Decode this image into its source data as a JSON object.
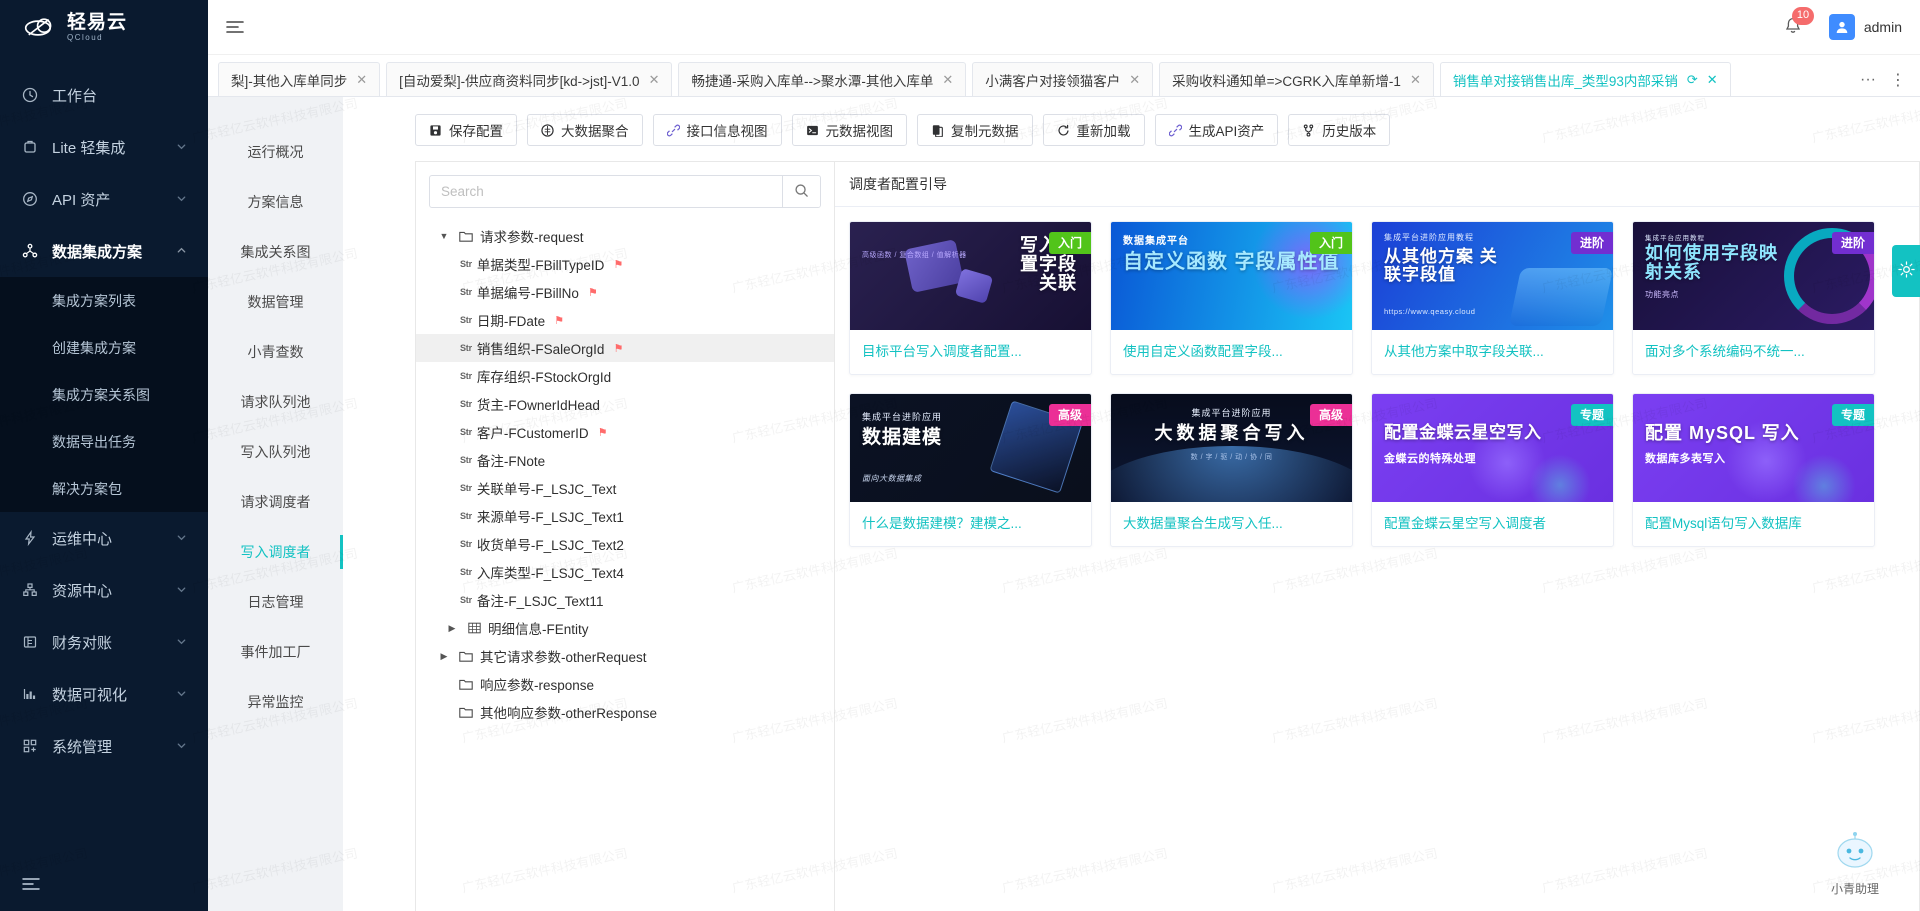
{
  "brand": {
    "title": "轻易云",
    "subtitle": "QCloud",
    "logo_icon": "qcloud-logo-icon"
  },
  "sidebar": {
    "collapse_icon": "collapse-sidebar-icon",
    "items": [
      {
        "label": "工作台",
        "icon": "clock-icon",
        "expandable": false
      },
      {
        "label": "Lite 轻集成",
        "icon": "lite-icon",
        "expandable": true
      },
      {
        "label": "API 资产",
        "icon": "api-compass-icon",
        "expandable": true
      },
      {
        "label": "数据集成方案",
        "icon": "integration-node-icon",
        "expandable": true,
        "active": true
      },
      {
        "label": "运维中心",
        "icon": "bolt-icon",
        "expandable": true
      },
      {
        "label": "资源中心",
        "icon": "resource-icon",
        "expandable": true
      },
      {
        "label": "财务对账",
        "icon": "finance-icon",
        "expandable": true
      },
      {
        "label": "数据可视化",
        "icon": "chart-icon",
        "expandable": true
      },
      {
        "label": "系统管理",
        "icon": "grid-settings-icon",
        "expandable": true
      }
    ],
    "sub_items": [
      {
        "label": "集成方案列表"
      },
      {
        "label": "创建集成方案"
      },
      {
        "label": "集成方案关系图"
      },
      {
        "label": "数据导出任务"
      },
      {
        "label": "解决方案包"
      }
    ]
  },
  "topbar": {
    "menu_icon": "hamburger-icon",
    "bell_icon": "bell-icon",
    "notification_count": "10",
    "user_name": "admin",
    "avatar_icon": "user-avatar-icon"
  },
  "tabs": {
    "items": [
      {
        "label": "梨]-其他入库单同步",
        "active": false
      },
      {
        "label": "[自动爱梨]-供应商资料同步[kd->jst]-V1.0",
        "active": false
      },
      {
        "label": "畅捷通-采购入库单-->聚水潭-其他入库单",
        "active": false
      },
      {
        "label": "小满客户对接领猫客户",
        "active": false
      },
      {
        "label": "采购收料通知单=>CGRK入库单新增-1",
        "active": false
      },
      {
        "label": "销售单对接销售出库_类型93内部采销",
        "active": true
      }
    ],
    "reload_icon": "reload-icon",
    "close_icon": "close-icon",
    "more_icon": "ellipsis-horizontal-icon",
    "menu_icon": "ellipsis-vertical-icon"
  },
  "submenu": {
    "items": [
      {
        "label": "运行概况"
      },
      {
        "label": "方案信息"
      },
      {
        "label": "集成关系图"
      },
      {
        "label": "数据管理"
      },
      {
        "label": "小青查数"
      },
      {
        "label": "请求队列池"
      },
      {
        "label": "写入队列池"
      },
      {
        "label": "请求调度者"
      },
      {
        "label": "写入调度者",
        "active": true
      },
      {
        "label": "日志管理"
      },
      {
        "label": "事件加工厂"
      },
      {
        "label": "异常监控"
      }
    ]
  },
  "toolbar": {
    "buttons": [
      {
        "label": "保存配置",
        "icon": "save-icon"
      },
      {
        "label": "大数据聚合",
        "icon": "bigdata-icon"
      },
      {
        "label": "接口信息视图",
        "icon": "link-icon"
      },
      {
        "label": "元数据视图",
        "icon": "terminal-icon"
      },
      {
        "label": "复制元数据",
        "icon": "copy-icon"
      },
      {
        "label": "重新加载",
        "icon": "refresh-icon"
      },
      {
        "label": "生成API资产",
        "icon": "link-icon"
      },
      {
        "label": "历史版本",
        "icon": "branch-icon"
      }
    ]
  },
  "search": {
    "value": "",
    "placeholder": "Search",
    "icon": "search-icon"
  },
  "tree": {
    "nodes": [
      {
        "label": "请求参数-request",
        "type": "folder",
        "level": 0,
        "expanded": true,
        "caret": "▼",
        "icon": "folder-icon"
      },
      {
        "label": "单据类型-FBillTypeID",
        "type": "str",
        "level": 2,
        "flag": true
      },
      {
        "label": "单据编号-FBillNo",
        "type": "str",
        "level": 2,
        "flag": true
      },
      {
        "label": "日期-FDate",
        "type": "str",
        "level": 2,
        "flag": true
      },
      {
        "label": "销售组织-FSaleOrgId",
        "type": "str",
        "level": 2,
        "flag": true,
        "selected": true
      },
      {
        "label": "库存组织-FStockOrgId",
        "type": "str",
        "level": 2,
        "flag": false
      },
      {
        "label": "货主-FOwnerIdHead",
        "type": "str",
        "level": 2,
        "flag": false
      },
      {
        "label": "客户-FCustomerID",
        "type": "str",
        "level": 2,
        "flag": true
      },
      {
        "label": "备注-FNote",
        "type": "str",
        "level": 2,
        "flag": false
      },
      {
        "label": "关联单号-F_LSJC_Text",
        "type": "str",
        "level": 2,
        "flag": false
      },
      {
        "label": "来源单号-F_LSJC_Text1",
        "type": "str",
        "level": 2,
        "flag": false
      },
      {
        "label": "收货单号-F_LSJC_Text2",
        "type": "str",
        "level": 2,
        "flag": false
      },
      {
        "label": "入库类型-F_LSJC_Text4",
        "type": "str",
        "level": 2,
        "flag": false
      },
      {
        "label": "备注-F_LSJC_Text11",
        "type": "str",
        "level": 2,
        "flag": false
      },
      {
        "label": "明细信息-FEntity",
        "type": "table",
        "level": 1,
        "caret": "▶",
        "icon": "table-icon"
      },
      {
        "label": "其它请求参数-otherRequest",
        "type": "folder",
        "level": 0,
        "caret": "▶",
        "icon": "folder-icon"
      },
      {
        "label": "响应参数-response",
        "type": "folder",
        "level": 0,
        "caret": "",
        "icon": "folder-icon"
      },
      {
        "label": "其他响应参数-otherResponse",
        "type": "folder",
        "level": 0,
        "caret": "",
        "icon": "folder-icon"
      }
    ]
  },
  "guide": {
    "title": "调度者配置引导",
    "cards": [
      {
        "caption": "目标平台写入调度者配置...",
        "ribbon": "入门",
        "ribbon_color": "#52c41a",
        "thumb_kicker": "",
        "thumb_title": "写入配置字段关联",
        "thumb_sub": "高级函数 / 复合数组 / 值解析器",
        "bg_from": "#2a2150",
        "bg_to": "#171033"
      },
      {
        "caption": "使用自定义函数配置字段...",
        "ribbon": "入门",
        "ribbon_color": "#52c41a",
        "thumb_kicker": "数据集成平台",
        "thumb_title": "自定义函数 字段属性值",
        "thumb_sub": "",
        "bg_from": "#0a58d6",
        "bg_to": "#1ac5f5"
      },
      {
        "caption": "从其他方案中取字段关联...",
        "ribbon": "进阶",
        "ribbon_color": "#722ed1",
        "thumb_kicker": "集成平台进阶应用教程",
        "thumb_title": "从其他方案 关联字段值",
        "thumb_sub": "https://www.qeasy.cloud",
        "bg_from": "#1b3fd6",
        "bg_to": "#1f8fe8"
      },
      {
        "caption": "面对多个系统编码不统一...",
        "ribbon": "进阶",
        "ribbon_color": "#722ed1",
        "thumb_kicker": "集成平台应用教程",
        "thumb_title": "如何使用字段映射关系",
        "thumb_sub": "功能亮点",
        "bg_from": "#18103a",
        "bg_to": "#2b1b63"
      },
      {
        "caption": "什么是数据建模？建模之...",
        "ribbon": "高级",
        "ribbon_color": "#eb2f96",
        "thumb_kicker": "集成平台进阶应用",
        "thumb_title": "数据建模",
        "thumb_sub": "面向大数据集成",
        "bg_from": "#0b1224",
        "bg_to": "#0a0f1c"
      },
      {
        "caption": "大数据量聚合生成写入任...",
        "ribbon": "高级",
        "ribbon_color": "#eb2f96",
        "thumb_kicker": "集成平台进阶应用",
        "thumb_title": "大数据聚合写入",
        "thumb_sub": "数 / 字 / 驱 / 动 / 协 / 同",
        "bg_from": "#070c1c",
        "bg_to": "#0d1733"
      },
      {
        "caption": "配置金蝶云星空写入调度者",
        "ribbon": "专题",
        "ribbon_color": "#13c2c2",
        "thumb_kicker": "",
        "thumb_title": "配置金蝶云星空写入",
        "thumb_sub": "金蝶云的特殊处理",
        "bg_from": "#7b3ff2",
        "bg_to": "#6a30e0"
      },
      {
        "caption": "配置Mysql语句写入数据库",
        "ribbon": "专题",
        "ribbon_color": "#13c2c2",
        "thumb_kicker": "",
        "thumb_title": "配置 MySQL 写入",
        "thumb_sub": "数据库多表写入",
        "bg_from": "#7b3ff2",
        "bg_to": "#6a30e0"
      }
    ]
  },
  "floating": {
    "gear_icon": "gear-icon",
    "assistant_label": "小青助理",
    "assistant_icon": "assistant-robot-icon"
  },
  "watermark_text": "广东轻亿云软件科技有限公司",
  "colors": {
    "accent": "#13c2c2",
    "sidebar_bg": "#0a1a2f",
    "danger": "#f56c6c"
  }
}
